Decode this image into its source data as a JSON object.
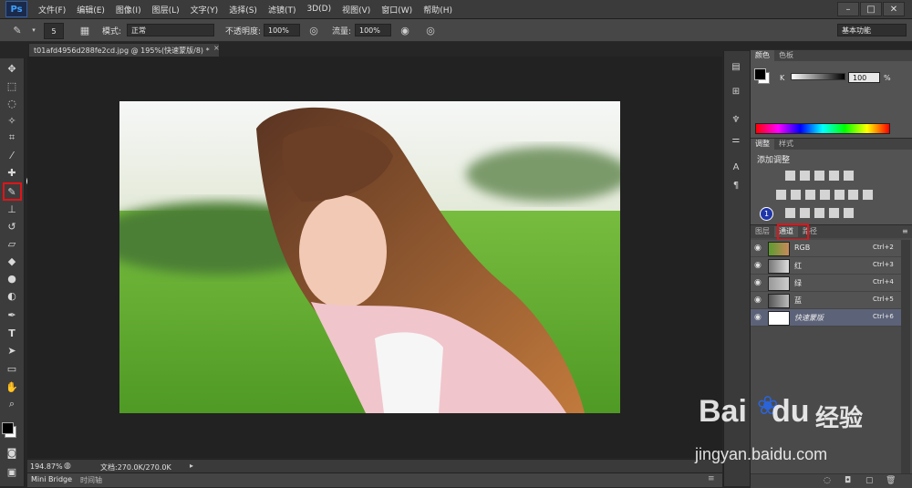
{
  "app": {
    "logo": "Ps"
  },
  "menu": [
    {
      "label": "文件(F)"
    },
    {
      "label": "编辑(E)"
    },
    {
      "label": "图像(I)"
    },
    {
      "label": "图层(L)"
    },
    {
      "label": "文字(Y)"
    },
    {
      "label": "选择(S)"
    },
    {
      "label": "滤镜(T)"
    },
    {
      "label": "3D(D)"
    },
    {
      "label": "视图(V)"
    },
    {
      "label": "窗口(W)"
    },
    {
      "label": "帮助(H)"
    }
  ],
  "options": {
    "brush_size": "5",
    "mode_label": "模式:",
    "mode_value": "正常",
    "opacity_label": "不透明度:",
    "opacity_value": "100%",
    "flow_label": "流量:",
    "flow_value": "100%",
    "workspace": "基本功能"
  },
  "document": {
    "tab_title": "t01afd4956d288fe2cd.jpg @ 195%(快速蒙版/8) *",
    "zoom": "194.87%",
    "doc_size": "文档:270.0K/270.0K"
  },
  "bottom_tabs": {
    "mini_bridge": "Mini Bridge",
    "timeline": "时间轴"
  },
  "color_panel": {
    "tabs": [
      "颜色",
      "色板"
    ],
    "channel_label": "K",
    "value": "100",
    "unit": "%"
  },
  "adjust_panel": {
    "tabs": [
      "调整",
      "样式"
    ],
    "title": "添加调整"
  },
  "channels_panel": {
    "tabs": [
      "图层",
      "通道",
      "路径"
    ],
    "rows": [
      {
        "name": "RGB",
        "shortcut": "Ctrl+2"
      },
      {
        "name": "红",
        "shortcut": "Ctrl+3"
      },
      {
        "name": "绿",
        "shortcut": "Ctrl+4"
      },
      {
        "name": "蓝",
        "shortcut": "Ctrl+5"
      },
      {
        "name": "快速蒙版",
        "shortcut": "Ctrl+6"
      }
    ]
  },
  "annotations": {
    "badge1": "1",
    "badge2": "2"
  },
  "watermark": {
    "site": "jingyan.baidu.com",
    "brand": "Bai",
    "brand2": "du",
    "brand3": "经验"
  },
  "colors": {
    "accent_red": "#e0141a",
    "badge_blue": "#1f36a8",
    "baidu_blue": "#2b64d8"
  }
}
